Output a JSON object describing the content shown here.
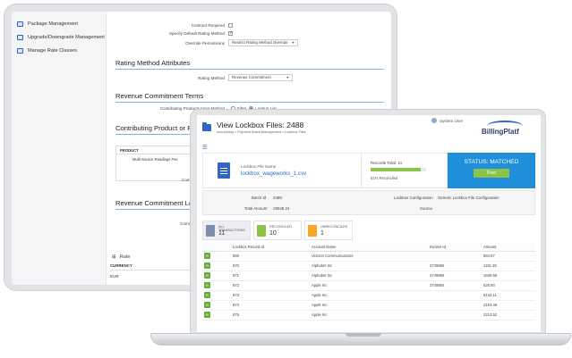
{
  "back_app": {
    "sidebar": {
      "items": [
        {
          "label": "Package Management",
          "icon": "package-icon"
        },
        {
          "label": "Upgrade/Downgrade Management",
          "icon": "upgrade-icon"
        },
        {
          "label": "Manage Rate Classes",
          "icon": "rate-class-icon"
        }
      ]
    },
    "form": {
      "contract_required_label": "Contract Required",
      "specify_default_label": "Specify Default Rating Method",
      "override_permissions_label": "Override Permissions",
      "override_permissions_value": "Restrict Rating Method Override",
      "rating_method_section": "Rating Method Attributes",
      "rating_method_label": "Rating Method",
      "rating_method_value": "Revenue Commitment",
      "revenue_terms_section": "Revenue Commitment Terms",
      "contributing_input_label": "Contributing Products Input Method",
      "radio_filter": "Filter",
      "radio_lookup": "Lookup List",
      "contributing_section": "Contributing Product or Pac",
      "table_header": "PRODUCT",
      "table_row": "Multi-Source Readings Fee",
      "field_comm": "Comm",
      "field_commitment": "Commitment",
      "revenue_levels_section": "Revenue Commitment Leve",
      "field_upto": "Upto",
      "field_commitment2": "Commitm",
      "rate_label": "Rate",
      "currency_header": "CURRENCY",
      "currency_value": "EUR"
    }
  },
  "front_app": {
    "title": "View Lockbox Files: 2488",
    "breadcrumb": "Accounting > Payment Batch Management > Lockbox Files",
    "user": "System User",
    "brand": "BillingPlatf",
    "file": {
      "label": "Lockbox File Name",
      "name": "lockbox_wageworks_1.csv"
    },
    "records": {
      "label": "Records Total: 11",
      "reconciled_fraction": 0.91,
      "percent_text": "91% Reconciled"
    },
    "status": {
      "text": "STATUS: MATCHED",
      "post_label": "Post"
    },
    "info": {
      "batch_id_label": "Batch Id",
      "batch_id_value": "2488",
      "total_amount_label": "Total Amount",
      "total_amount_value": "28048.34",
      "lockbox_config_label": "Lockbox Configuration",
      "lockbox_config_value": "Generic Lockbox File Configuration",
      "source_label": "Source"
    },
    "summary_tabs": [
      {
        "label": "ALL TRANSACTIONS",
        "count": "11",
        "color": "#7d8fa8"
      },
      {
        "label": "RECONCILED",
        "count": "10",
        "color": "#8bc34a"
      },
      {
        "label": "UNRECONCILED",
        "count": "1",
        "color": "#f5a623"
      }
    ],
    "table": {
      "headers": [
        "",
        "Lockbox Record Id",
        "Account Name",
        "Invoice Id",
        "Amount"
      ],
      "rows": [
        {
          "badge": "R",
          "record_id": "869",
          "account": "Verizon Communications",
          "invoice": "",
          "amount": "864.67"
        },
        {
          "badge": "R",
          "record_id": "870",
          "account": "Alphabet Inc",
          "invoice": "3749865",
          "amount": "1161.35"
        },
        {
          "badge": "R",
          "record_id": "871",
          "account": "Alphabet Inc",
          "invoice": "3749865",
          "amount": "1639.69"
        },
        {
          "badge": "R",
          "record_id": "872",
          "account": "Apple Inc",
          "invoice": "3749864",
          "amount": "626.60"
        },
        {
          "badge": "R",
          "record_id": "873",
          "account": "Apple Inc",
          "invoice": "",
          "amount": "5143.11"
        },
        {
          "badge": "R",
          "record_id": "874",
          "account": "Apple Inc",
          "invoice": "",
          "amount": "2153.48"
        },
        {
          "badge": "R",
          "record_id": "875",
          "account": "Apple Inc",
          "invoice": "",
          "amount": "2213.52"
        }
      ]
    }
  }
}
